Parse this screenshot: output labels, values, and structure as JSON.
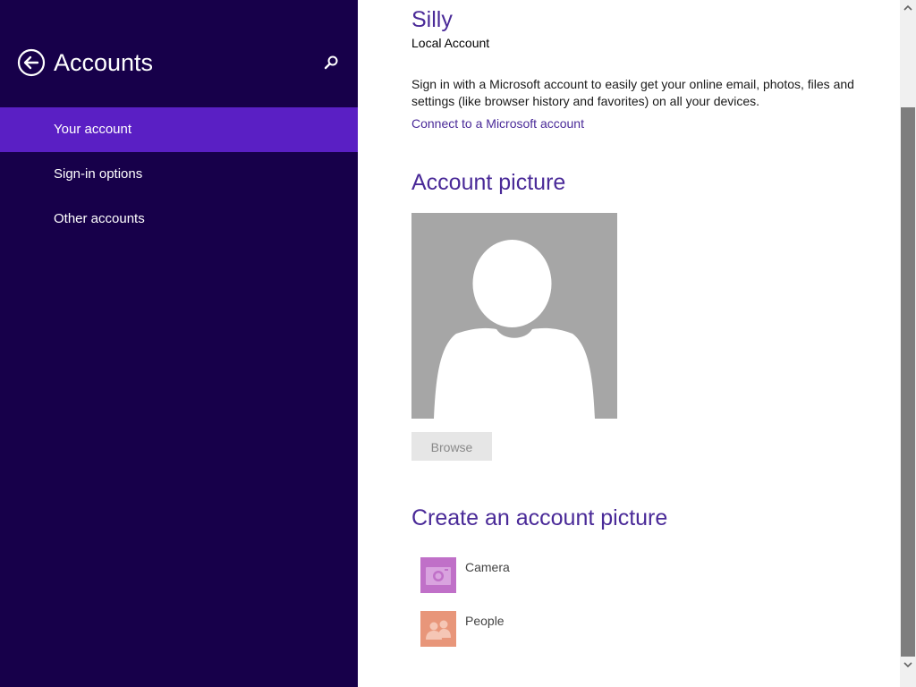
{
  "nav": {
    "title": "Accounts",
    "back_icon": "back-arrow-circle-icon",
    "search_icon": "search-icon",
    "items": [
      {
        "label": "Your account",
        "selected": true
      },
      {
        "label": "Sign-in options",
        "selected": false
      },
      {
        "label": "Other accounts",
        "selected": false
      }
    ]
  },
  "account": {
    "username": "Silly",
    "type": "Local Account",
    "description": "Sign in with a Microsoft account to easily get your online email, photos, files and settings (like browser history and favorites) on all your devices.",
    "connect_link": "Connect to a Microsoft account"
  },
  "picture": {
    "title": "Account picture",
    "avatar_icon": "default-user-silhouette",
    "browse_label": "Browse"
  },
  "create": {
    "title": "Create an account picture",
    "apps": [
      {
        "label": "Camera",
        "icon": "camera-icon",
        "color": "#c070c8"
      },
      {
        "label": "People",
        "icon": "people-icon",
        "color": "#e8967a"
      }
    ]
  },
  "colors": {
    "nav_background": "#17004a",
    "nav_selected": "#5a1fc4",
    "accent_text": "#4a2a98"
  }
}
